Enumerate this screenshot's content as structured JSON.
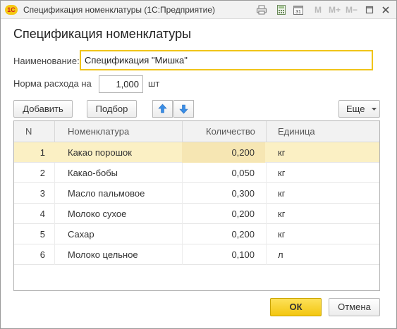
{
  "window": {
    "app_logo": "1С",
    "title": "Спецификация номенклатуры  (1С:Предприятие)",
    "calendar_day": "31",
    "m_buttons": [
      "M",
      "M+",
      "M−"
    ]
  },
  "dialog": {
    "title": "Спецификация номенклатуры"
  },
  "form": {
    "name_label": "Наименование:",
    "name_value": "Спецификация \"Мишка\"",
    "rate_label": "Норма расхода на",
    "rate_value": "1,000",
    "rate_unit": "шт"
  },
  "toolbar": {
    "add_label": "Добавить",
    "pick_label": "Подбор",
    "more_label": "Еще"
  },
  "table": {
    "columns": [
      "N",
      "Номенклатура",
      "Количество",
      "Единица"
    ],
    "rows": [
      {
        "n": "1",
        "item": "Какао порошок",
        "qty": "0,200",
        "unit": "кг"
      },
      {
        "n": "2",
        "item": "Какао-бобы",
        "qty": "0,050",
        "unit": "кг"
      },
      {
        "n": "3",
        "item": "Масло пальмовое",
        "qty": "0,300",
        "unit": "кг"
      },
      {
        "n": "4",
        "item": "Молоко сухое",
        "qty": "0,200",
        "unit": "кг"
      },
      {
        "n": "5",
        "item": "Сахар",
        "qty": "0,200",
        "unit": "кг"
      },
      {
        "n": "6",
        "item": "Молоко цельное",
        "qty": "0,100",
        "unit": "л"
      }
    ],
    "selected_row": 0
  },
  "footer": {
    "ok_label": "ОК",
    "cancel_label": "Отмена"
  },
  "colors": {
    "accent_yellow": "#f3c60f",
    "selected_row": "#fbf0c4",
    "arrow_blue": "#3a8ee6"
  }
}
